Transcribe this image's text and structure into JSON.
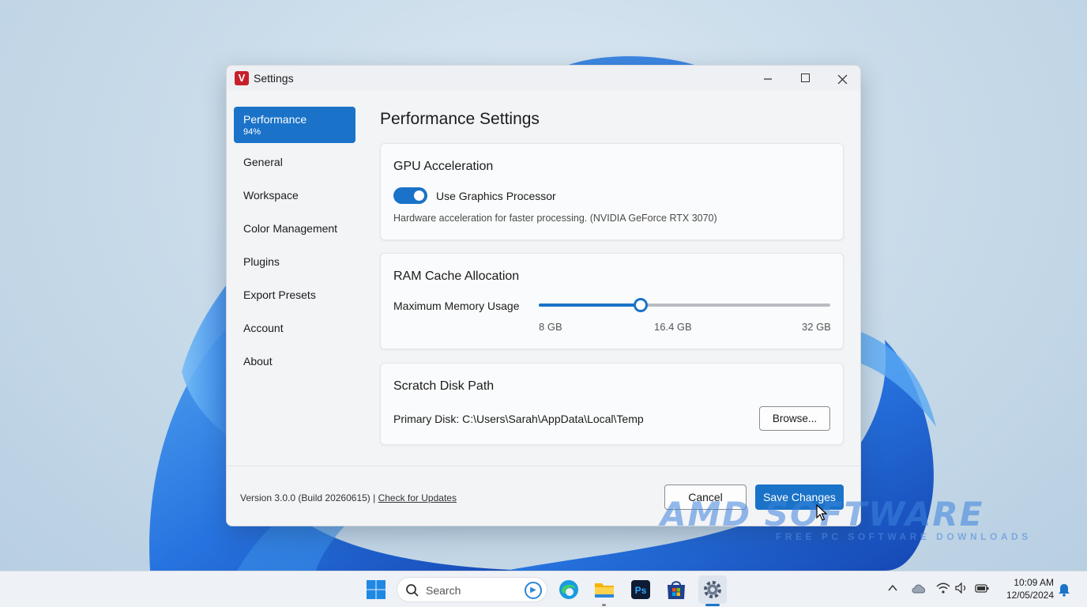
{
  "window": {
    "title": "Settings",
    "app_logo": "V",
    "controls": {
      "minimize": "minimize-icon",
      "maximize": "maximize-icon",
      "close": "close-icon"
    }
  },
  "sidebar": {
    "items": [
      {
        "label": "Performance",
        "sub": "94%",
        "active": true
      },
      {
        "label": "General"
      },
      {
        "label": "Workspace"
      },
      {
        "label": "Color Management"
      },
      {
        "label": "Plugins"
      },
      {
        "label": "Export Presets"
      },
      {
        "label": "Account"
      },
      {
        "label": "About"
      }
    ]
  },
  "main": {
    "title": "Performance Settings",
    "gpu": {
      "title": "GPU Acceleration",
      "toggle_label": "Use Graphics Processor",
      "toggle_on": true,
      "description": "Hardware acceleration for faster processing. (NVIDIA GeForce RTX 3070)"
    },
    "ram": {
      "title": "RAM Cache Allocation",
      "label": "Maximum Memory Usage",
      "min_label": "8 GB",
      "current_label": "16.4 GB",
      "max_label": "32 GB",
      "min": 8,
      "max": 32,
      "value": 16.4
    },
    "disk": {
      "title": "Scratch Disk Path",
      "path": "Primary Disk: C:\\Users\\Sarah\\AppData\\Local\\Temp",
      "browse_label": "Browse..."
    }
  },
  "footer": {
    "version": "Version 3.0.0 (Build 20260615) |",
    "updates_link": "Check for Updates",
    "cancel_label": "Cancel",
    "save_label": "Save Changes"
  },
  "watermark": {
    "main": "AMD SOFTWARE",
    "sub": "FREE PC SOFTWARE DOWNLOADS"
  },
  "taskbar": {
    "search_placeholder": "Search",
    "clock_time": "10:09 AM",
    "clock_date": "12/05/2024",
    "apps": [
      "start-icon",
      "edge-icon",
      "file-explorer-icon",
      "photoshop-icon",
      "store-icon",
      "settings-icon"
    ]
  },
  "colors": {
    "accent": "#1a73c8",
    "window_bg": "#f3f4f6",
    "card_bg": "#fafbfc",
    "logo_red": "#c8202a"
  }
}
